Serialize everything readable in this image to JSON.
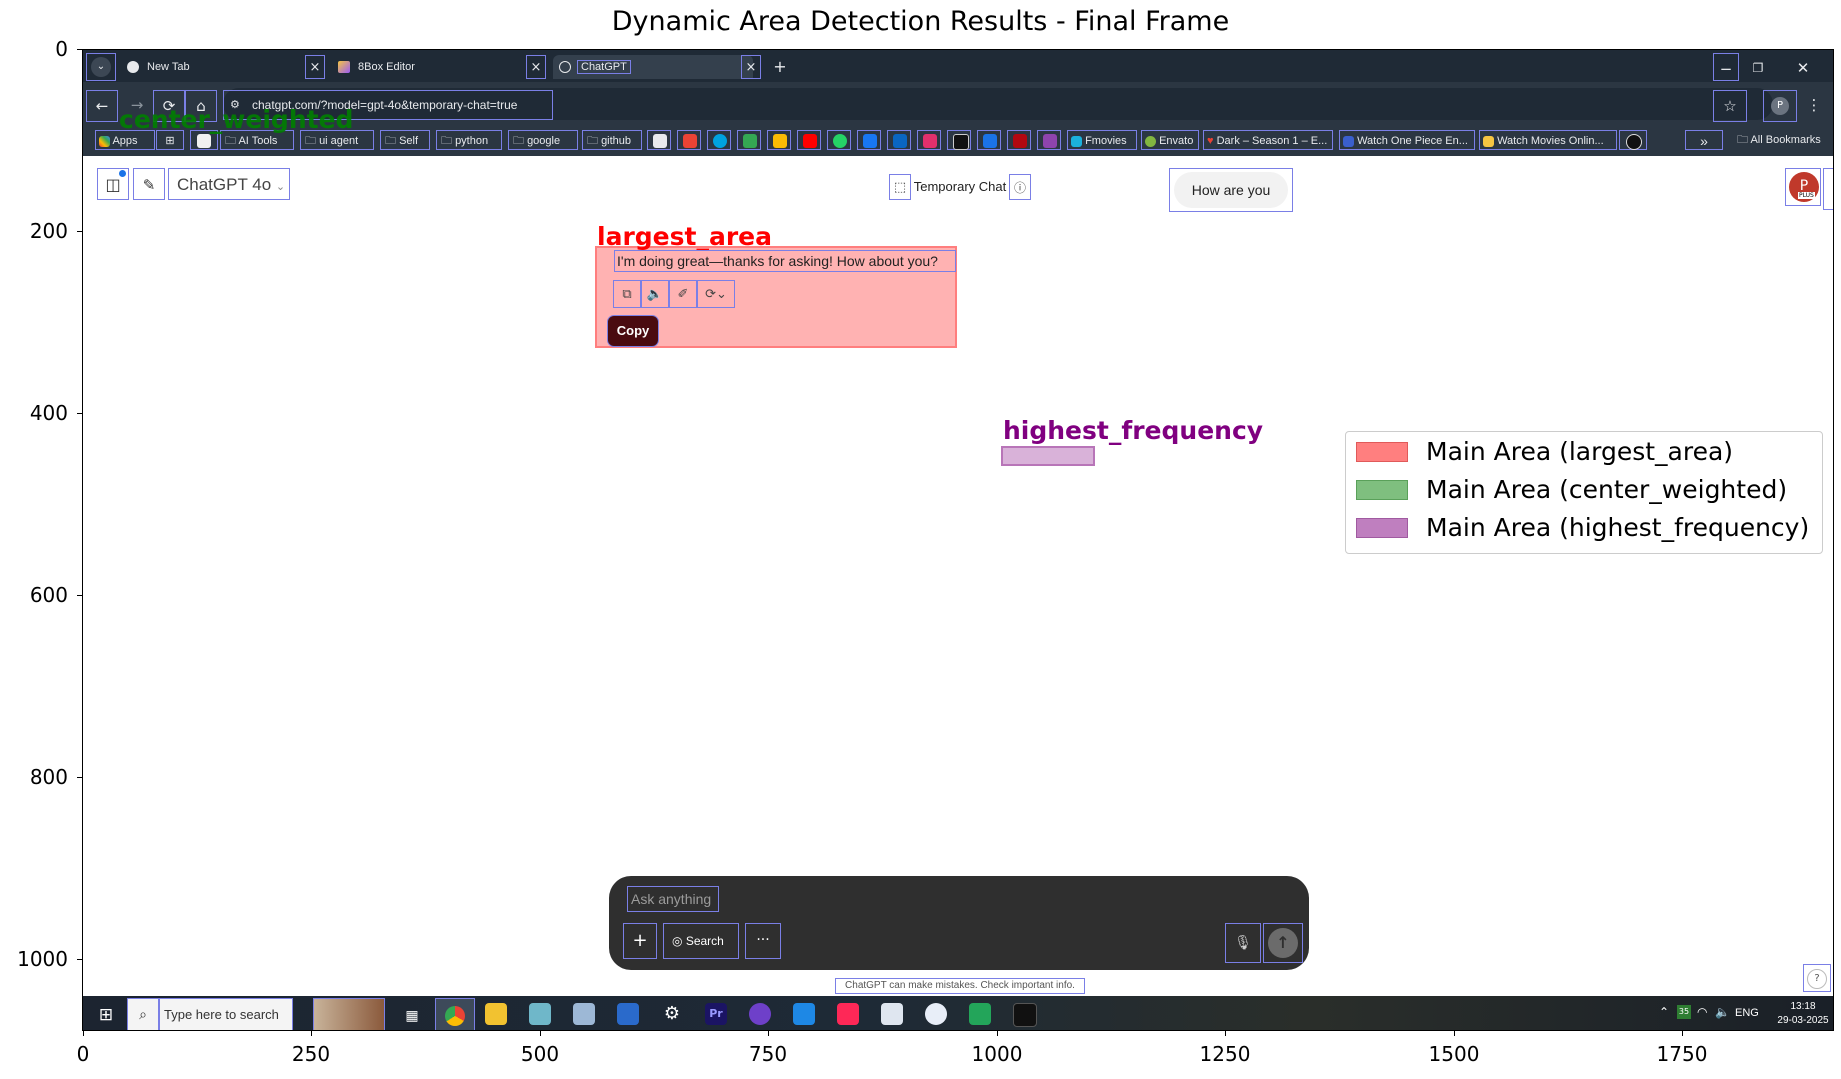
{
  "figure": {
    "title": "Dynamic Area Detection Results - Final Frame",
    "x_ticks": [
      "0",
      "250",
      "500",
      "750",
      "1000",
      "1250",
      "1500",
      "1750"
    ],
    "y_ticks": [
      "0",
      "200",
      "400",
      "600",
      "800",
      "1000"
    ],
    "legend": [
      {
        "label": "Main Area (largest_area)",
        "color": "#ff7f7f"
      },
      {
        "label": "Main Area (center_weighted)",
        "color": "#7fbf7f"
      },
      {
        "label": "Main Area (highest_frequency)",
        "color": "#bf7fbf"
      }
    ],
    "region_labels": {
      "largest_area": "largest_area",
      "center_weighted": "center_weighted",
      "highest_frequency": "highest_frequency"
    },
    "colors": {
      "largest": "#ff0000",
      "center": "#008000",
      "frequency": "#800080",
      "detection_box": "#7a7fe6"
    }
  },
  "browser": {
    "tabs": [
      {
        "label": "New Tab",
        "close": "×"
      },
      {
        "label": "8Box Editor",
        "close": "×"
      },
      {
        "label": "ChatGPT",
        "close": "×"
      }
    ],
    "new_tab": "+",
    "url": "chatgpt.com/?model=gpt-4o&temporary-chat=true",
    "bookmarks": [
      "Apps",
      "AI Tools",
      "ui agent",
      "Self",
      "python",
      "google",
      "github",
      "Fmovies",
      "Envato",
      "Dark – Season 1 – E...",
      "Watch One Piece En...",
      "Watch Movies Onlin...",
      "All Bookmarks"
    ],
    "more": "»"
  },
  "chat": {
    "model": "ChatGPT 4o",
    "temporary": "Temporary Chat",
    "user_message": "How are you",
    "assistant_message": "I'm doing great—thanks for asking! How about you?",
    "tooltip": "Copy",
    "input_placeholder": "Ask anything",
    "search_button": "Search",
    "more_button": "···",
    "disclaimer": "ChatGPT can make mistakes. Check important info.",
    "help": "?",
    "avatar": "P",
    "avatar_badge": "PLUS"
  },
  "taskbar": {
    "search_placeholder": "Type here to search",
    "time": "13:18",
    "date": "29-03-2025",
    "lang": "ENG",
    "battery": "35"
  }
}
